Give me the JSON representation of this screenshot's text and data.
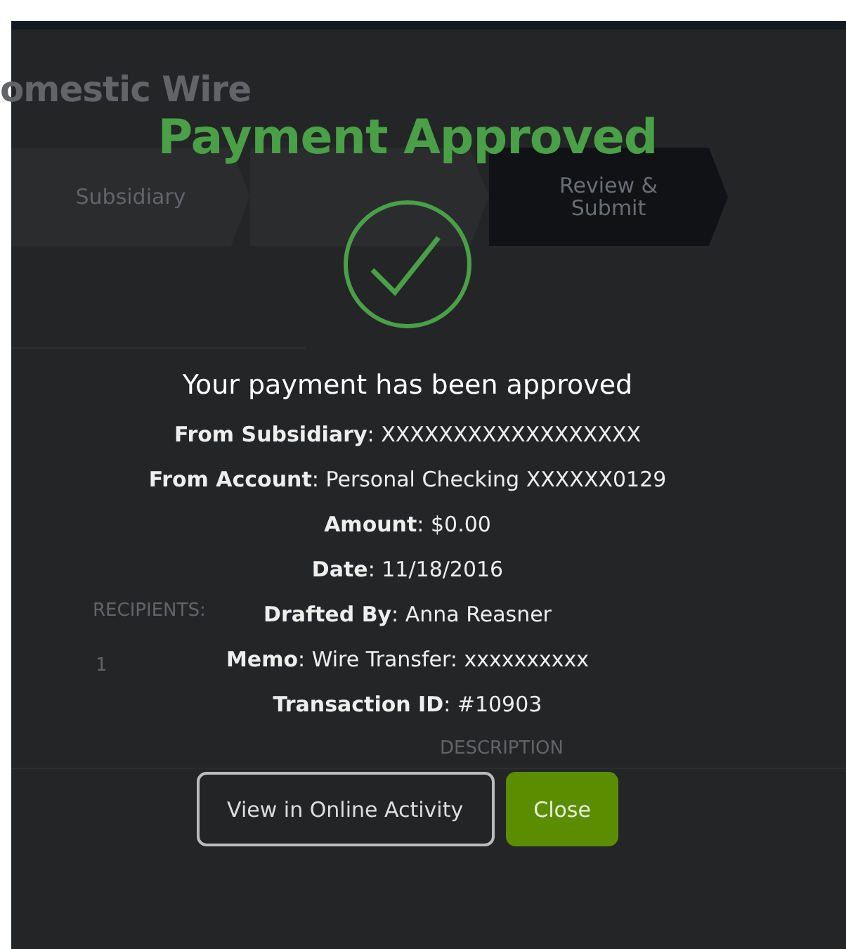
{
  "background": {
    "heading": "omestic Wire",
    "steps": [
      {
        "label": "Subsidiary",
        "selected": false
      },
      {
        "selected": false
      },
      {
        "label": "Review & Submit",
        "selected": true
      }
    ],
    "recipients_label": "RECIPIENTS:",
    "recipient_number": "1",
    "description_label": "DESCRIPTION"
  },
  "dialog": {
    "title": "Payment Approved",
    "message": "Your payment has been approved",
    "details": [
      "**From Subsidiary**: XXXXXXXXXXXXXXXXXX",
      "**From Account**: Personal Checking XXXXXX0129",
      "**Amount**: $0.00",
      "**Date**: 11/18/2016",
      "**Drafted By**: Anna Reasner",
      "**Memo**: Wire Transfer: xxxxxxxxxx",
      "**Transaction ID**: #10903"
    ],
    "buttons": [
      {
        "label": "View in Online Activity",
        "kind": "secondary"
      },
      {
        "label": "Close",
        "kind": "primary"
      }
    ]
  }
}
